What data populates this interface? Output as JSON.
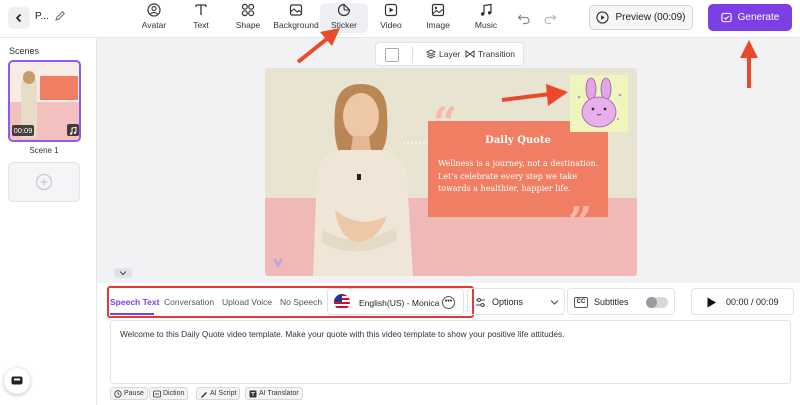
{
  "header": {
    "project_title": "P...",
    "tools": [
      {
        "label": "Avatar",
        "icon": "avatar-icon"
      },
      {
        "label": "Text",
        "icon": "text-icon"
      },
      {
        "label": "Shape",
        "icon": "shape-icon"
      },
      {
        "label": "Background",
        "icon": "background-icon"
      },
      {
        "label": "Sticker",
        "icon": "sticker-icon"
      },
      {
        "label": "Video",
        "icon": "video-icon"
      },
      {
        "label": "Image",
        "icon": "image-icon"
      },
      {
        "label": "Music",
        "icon": "music-icon"
      }
    ],
    "active_tool": "Sticker",
    "preview_label": "Preview (00:09)",
    "generate_label": "Generate"
  },
  "scenes": {
    "title": "Scenes",
    "items": [
      {
        "label": "Scene 1",
        "duration": "00:09"
      }
    ]
  },
  "layer_bar": {
    "layer_label": "Layer",
    "transition_label": "Transition"
  },
  "canvas": {
    "quote_title": "Daily Quote",
    "quote_text": "Wellness is a journey, not a  destination. Let's celebrate every step we take towards a healthier, happier life.",
    "colors": {
      "background": "#e9e3d2",
      "pink": "#f0b9b8",
      "quote_box": "#f07e62",
      "sticker_bg": "#eef5bd"
    }
  },
  "bottom": {
    "tabs": [
      "Speech Text",
      "Conversation",
      "Upload Voice",
      "No Speech"
    ],
    "active_tab": "Speech Text",
    "voice": "English(US) - Monica",
    "options_label": "Options",
    "subtitles_label": "Subtitles",
    "subtitles_on": false,
    "time": "00:00 / 00:09",
    "script": "Welcome to this Daily Quote video template. Make your quote with this video template to show your positive life attitudes.",
    "chips": [
      "Pause",
      "Diction",
      "AI Script",
      "AI Translator"
    ]
  },
  "colors": {
    "accent": "#7b3fe4",
    "annotation_red": "#e53935"
  }
}
